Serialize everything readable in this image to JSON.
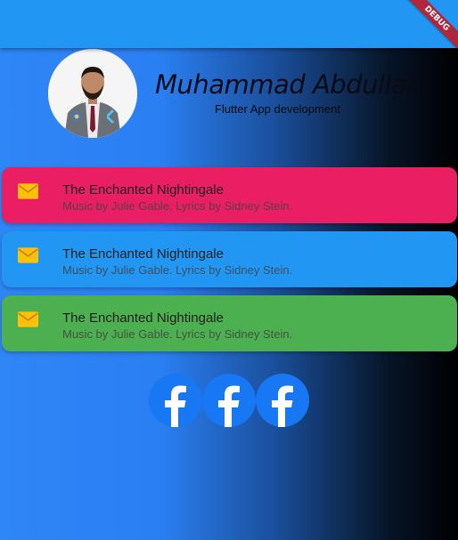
{
  "debug_banner": {
    "label": "DEBUG"
  },
  "profile": {
    "name": "Muhammad Abdullah",
    "subtitle": "Flutter App development"
  },
  "cards": [
    {
      "title": "The Enchanted Nightingale",
      "subtitle": "Music by Julie Gable. Lyrics by Sidney Stein.",
      "color": "#e91e63",
      "icon": "mail-icon"
    },
    {
      "title": "The Enchanted Nightingale",
      "subtitle": "Music by Julie Gable. Lyrics by Sidney Stein.",
      "color": "#2196f3",
      "icon": "mail-icon"
    },
    {
      "title": "The Enchanted Nightingale",
      "subtitle": "Music by Julie Gable. Lyrics by Sidney Stein.",
      "color": "#4caf50",
      "icon": "mail-icon"
    }
  ],
  "social_icons": [
    "facebook-icon",
    "facebook-icon",
    "facebook-icon"
  ],
  "colors": {
    "appbar": "#2196f3",
    "mail_icon": "#ffc107",
    "facebook": "#1877f2"
  }
}
